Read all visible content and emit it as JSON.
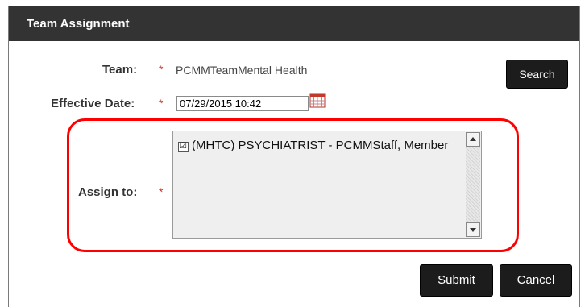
{
  "dialog": {
    "title": "Team Assignment",
    "required_marker": "*",
    "team": {
      "label": "Team:",
      "value": "PCMMTeamMental Health"
    },
    "search_button": "Search",
    "effective_date": {
      "label": "Effective Date:",
      "value": "07/29/2015 10:42"
    },
    "assign_to": {
      "label": "Assign to:",
      "items": [
        {
          "checked": true,
          "check_glyph": "☑",
          "text": "(MHTC) PSYCHIATRIST - PCMMStaff, Member"
        }
      ]
    },
    "submit_button": "Submit",
    "cancel_button": "Cancel"
  },
  "icons": {
    "calendar": "calendar-icon",
    "scroll_up": "scroll-up-arrow-icon",
    "scroll_down": "scroll-down-arrow-icon"
  },
  "colors": {
    "titlebar": "#333333",
    "button": "#1c1c1c",
    "required": "#c0392b",
    "highlight": "#ff0000"
  }
}
